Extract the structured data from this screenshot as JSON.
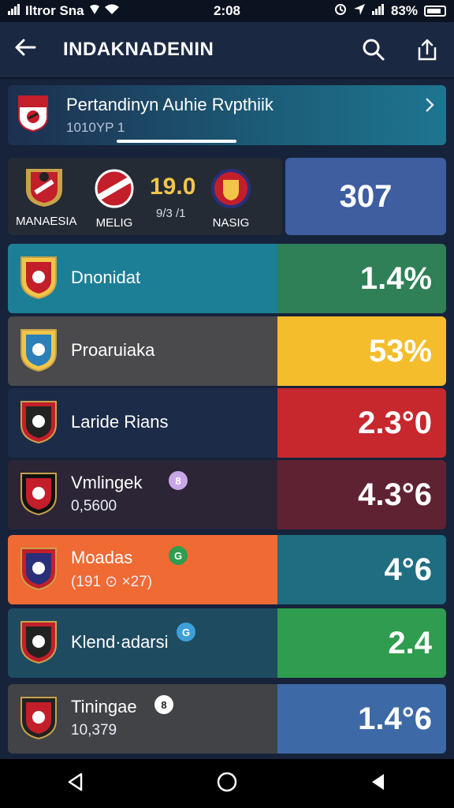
{
  "status_bar": {
    "carrier": "Iltror Sna",
    "time": "2:08",
    "battery": "83%"
  },
  "app_bar": {
    "title": "INDAKNADENIN",
    "icons": [
      "back-arrow-icon",
      "search-icon",
      "share-icon"
    ]
  },
  "banner": {
    "title": "Pertandinyn Auhie Rvpthiik",
    "subtitle": "1010YP 1"
  },
  "match": {
    "home_team": "MANAESIA",
    "mid_team": "MELIG",
    "away_team": "NASIG",
    "score": "19.0",
    "score_sub": "9/3 /1",
    "total": "307"
  },
  "teams": [
    {
      "name": "Dnonidat",
      "meta": "",
      "badge": "",
      "value": "1.4%",
      "left_color": "#1d7f96",
      "right_color": "#2f7f57"
    },
    {
      "name": "Proaruiaka",
      "meta": "",
      "badge": "",
      "value": "53%",
      "left_color": "#4a4a4c",
      "right_color": "#f4bd2c"
    },
    {
      "name": "Laride Rians",
      "meta": "",
      "badge": "",
      "value": "2.3°0",
      "left_color": "#1c2b47",
      "right_color": "#c6282e"
    },
    {
      "name": "Vmlingek",
      "meta": "0,5600",
      "badge": "8",
      "value": "4.3°6",
      "left_color": "#2b2535",
      "right_color": "#5f2233"
    },
    {
      "name": "Moadas",
      "meta": "(191 ⊙ ×27)",
      "badge": "G",
      "value": "4°6",
      "left_color": "#f06a34",
      "right_color": "#1f6d80"
    },
    {
      "name": "Klend·adarsi",
      "meta": "",
      "badge": "G",
      "value": "2.4",
      "left_color": "#1f4b61",
      "right_color": "#2f9c4f"
    },
    {
      "name": "Tiningae",
      "meta": "10,379",
      "badge": "8",
      "value": "1.4°6",
      "left_color": "#414347",
      "right_color": "#3d6aa6"
    }
  ]
}
